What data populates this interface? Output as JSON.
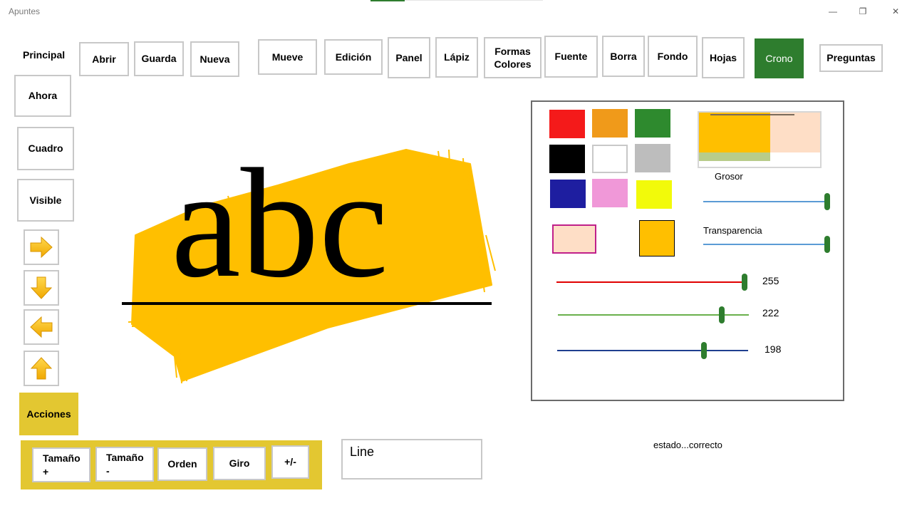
{
  "window": {
    "title": "Apuntes",
    "minimize": "—",
    "restore": "❐",
    "close": "✕"
  },
  "toolbar": {
    "principal": "Principal",
    "abrir": "Abrir",
    "guarda": "Guarda",
    "nueva": "Nueva",
    "mueve": "Mueve",
    "edicion": "Edición",
    "panel": "Panel",
    "lapiz": "Lápiz",
    "formas_colores": "Formas\nColores",
    "fuente": "Fuente",
    "borra": "Borra",
    "fondo": "Fondo",
    "hojas": "Hojas",
    "crono": "Crono",
    "preguntas": "Preguntas"
  },
  "sidebar": {
    "ahora": "Ahora",
    "cuadro": "Cuadro",
    "visible": "Visible",
    "acciones": "Acciones"
  },
  "actions": {
    "tamano_mas": "Tamaño\n+",
    "tamano_menos": "Tamaño\n-",
    "orden": "Orden",
    "giro": "Giro",
    "plus_minus": "+/-"
  },
  "canvas": {
    "text": "abc",
    "highlight_color": "#ffbf00"
  },
  "line_box": {
    "value": "Line"
  },
  "status": {
    "text": "estado...correcto"
  },
  "color_panel": {
    "swatches": [
      "#f41a1a",
      "#f09a1a",
      "#2e8a2e",
      "#000000",
      "#ffffff",
      "#bdbdbd",
      "#1e1ea0",
      "#f098d8",
      "#f2fa0a"
    ],
    "current_fill": "#fedec6",
    "current_fill_border": "#c0208a",
    "current_stroke": "#ffbf00",
    "grosor_label": "Grosor",
    "grosor": 1.0,
    "transparencia_label": "Transparencia",
    "transparencia": 1.0,
    "red": "255",
    "green": "222",
    "blue": "198"
  },
  "colors": {
    "accent_green": "#2e7d2e",
    "accent_yellow": "#e3c731"
  }
}
